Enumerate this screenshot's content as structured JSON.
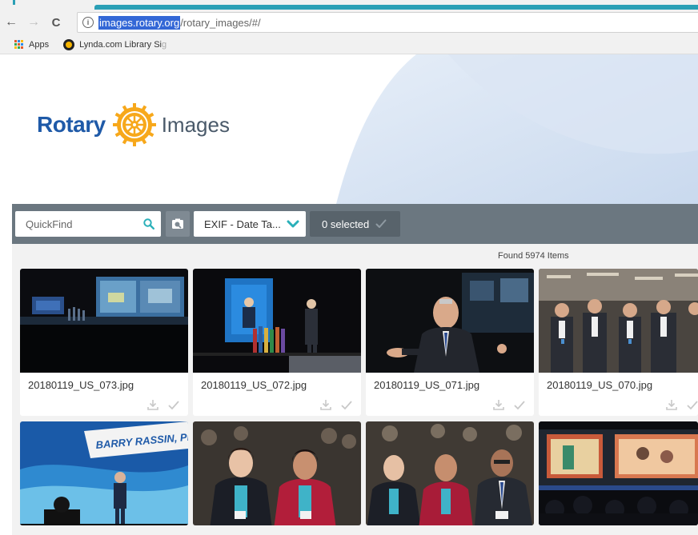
{
  "browser": {
    "back_glyph": "←",
    "forward_glyph": "→",
    "reload_glyph": "C",
    "info_glyph": "i",
    "url_host": "images.rotary.org",
    "url_path": "/rotary_images/#/",
    "bookmarks": [
      {
        "icon": "apps-grid-icon",
        "label": "Apps"
      },
      {
        "icon": "lynda-icon",
        "label": "Lynda.com Library Si",
        "label_fade": "g"
      }
    ]
  },
  "header": {
    "logo_word": "Rotary",
    "logo_suffix": "Images",
    "brand_blue": "#1f5aa8",
    "wheel_gold": "#f7a81b"
  },
  "toolbar": {
    "quickfind_placeholder": "QuickFind",
    "exif_select_value": "EXIF - Date Ta...",
    "selected_label": "0 selected",
    "accent_teal": "#2ab0b9"
  },
  "results": {
    "found_text": "Found 5974 Items",
    "items": [
      {
        "filename": "20180119_US_073.jpg",
        "scene": "stage-screens"
      },
      {
        "filename": "20180119_US_072.jpg",
        "scene": "speaker-blue-screen"
      },
      {
        "filename": "20180119_US_071.jpg",
        "scene": "speaker-closeup"
      },
      {
        "filename": "20180119_US_070.jpg",
        "scene": "audience"
      },
      {
        "filename": "",
        "scene": "barry-rassin-banner",
        "banner_text": "BARRY RASSIN, PRES"
      },
      {
        "filename": "",
        "scene": "women-seated"
      },
      {
        "filename": "",
        "scene": "group-seated"
      },
      {
        "filename": "",
        "scene": "stage-wide"
      }
    ]
  }
}
